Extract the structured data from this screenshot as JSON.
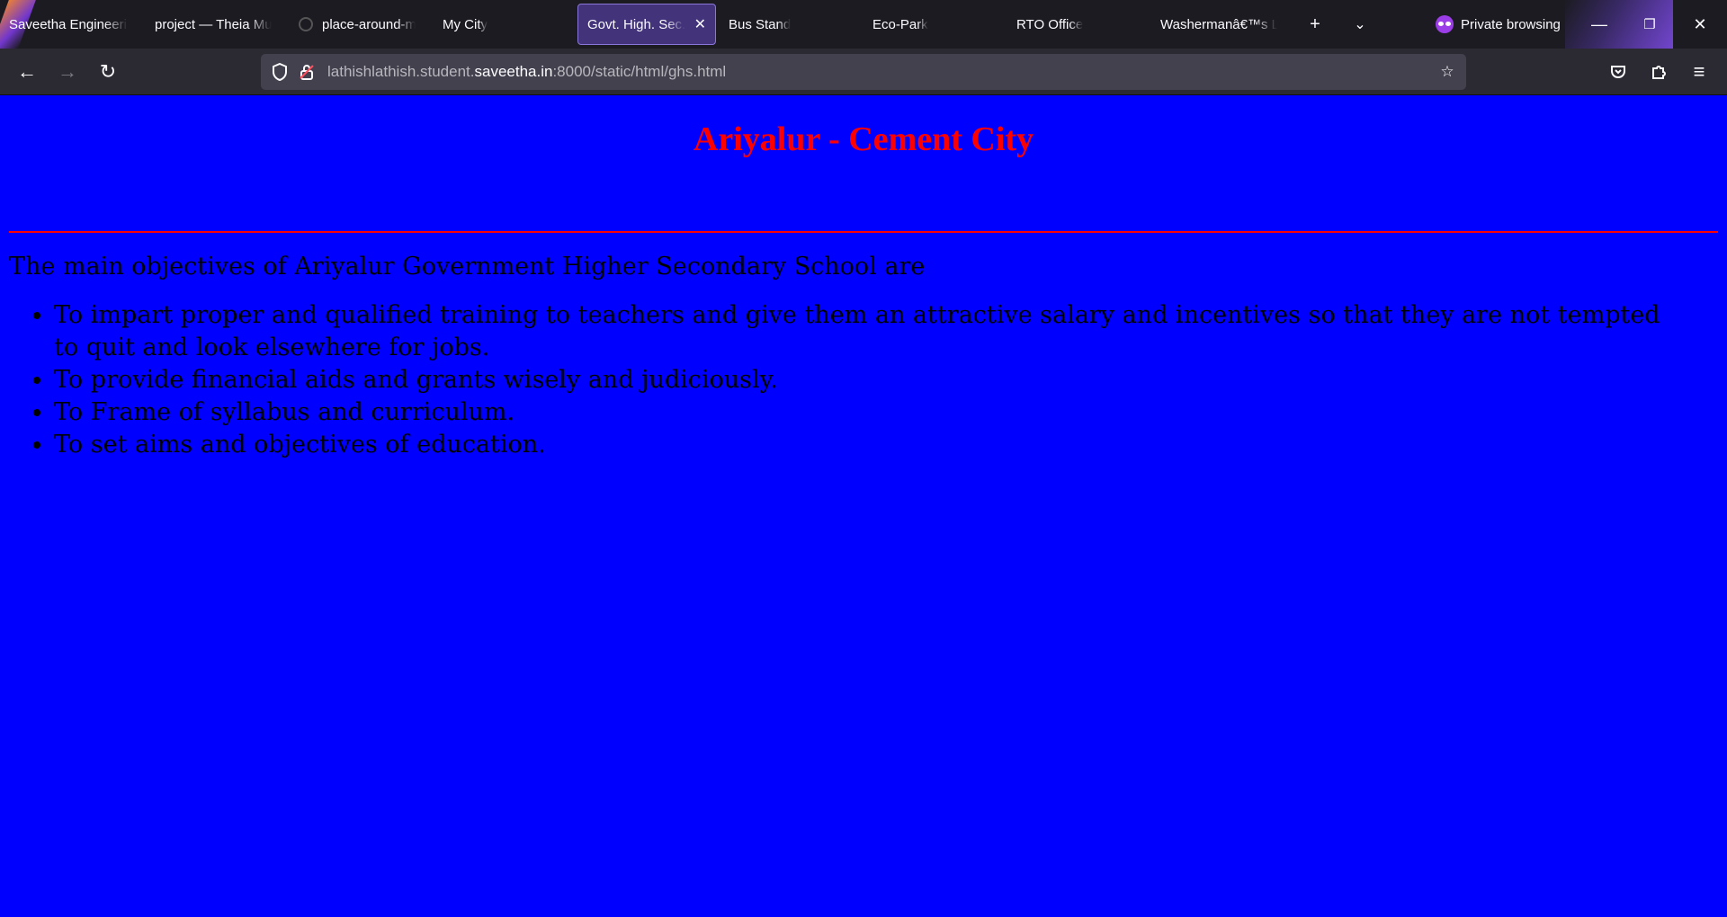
{
  "browser": {
    "tabs": [
      {
        "label": "Saveetha Engineering"
      },
      {
        "label": "project — Theia Multi"
      },
      {
        "label": "place-around-me"
      },
      {
        "label": "My City"
      },
      {
        "label": "Govt. High. Sec.",
        "selected": true
      },
      {
        "label": "Bus Stand"
      },
      {
        "label": "Eco-Park"
      },
      {
        "label": "RTO Office"
      },
      {
        "label": "Washermanâ€™s Land"
      }
    ],
    "private_label": "Private browsing",
    "url": {
      "prefix": "lathishlathish.student.",
      "host": "saveetha.in",
      "suffix": ":8000/static/html/ghs.html"
    }
  },
  "page": {
    "heading": "Ariyalur - Cement City",
    "heading_color": "#ff0000",
    "background_color": "#0000ff",
    "intro": "The main objectives of Ariyalur Government Higher Secondary School are",
    "objectives": [
      "To impart proper and qualified training to teachers and give them an attractive salary and incentives so that they are not tempted to quit and look elsewhere for jobs.",
      "To provide financial aids and grants wisely and judiciously.",
      "To Frame of syllabus and curriculum.",
      "To set aims and objectives of education."
    ]
  }
}
